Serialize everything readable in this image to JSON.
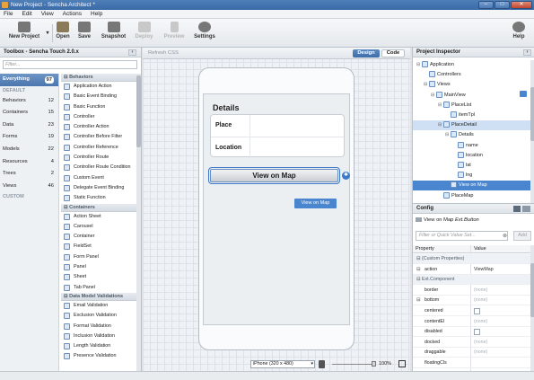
{
  "window": {
    "title": "New Project - Sencha Architect *",
    "minimize": "–",
    "maximize": "□",
    "close": "✕"
  },
  "menu": [
    "File",
    "Edit",
    "View",
    "Actions",
    "Help"
  ],
  "toolbar": {
    "new_project": "New Project",
    "open": "Open",
    "save": "Save",
    "snapshot": "Snapshot",
    "deploy": "Deploy",
    "preview": "Preview",
    "settings": "Settings",
    "help": "Help"
  },
  "toolbox": {
    "title": "Toolbox - Sencha Touch 2.0.x",
    "filter_placeholder": "Filter...",
    "categories": [
      {
        "label": "Everything",
        "count": "97"
      },
      {
        "label": "DEFAULT",
        "header": true
      },
      {
        "label": "Behaviors",
        "count": "12"
      },
      {
        "label": "Containers",
        "count": "15"
      },
      {
        "label": "Data",
        "count": "23"
      },
      {
        "label": "Forms",
        "count": "19"
      },
      {
        "label": "Models",
        "count": "22"
      },
      {
        "label": "Resources",
        "count": "4"
      },
      {
        "label": "Trees",
        "count": "2"
      },
      {
        "label": "Views",
        "count": "46"
      },
      {
        "label": "CUSTOM",
        "header": true
      }
    ],
    "groups": [
      {
        "name": "Behaviors",
        "items": [
          "Application Action",
          "Basic Event Binding",
          "Basic Function",
          "Controller",
          "Controller Action",
          "Controller Before Filter",
          "Controller Reference",
          "Controller Route",
          "Controller Route Condition",
          "Custom Event",
          "Delegate Event Binding",
          "Static Function"
        ]
      },
      {
        "name": "Containers",
        "items": [
          "Action Sheet",
          "Carousel",
          "Container",
          "FieldSet",
          "Form Panel",
          "Panel",
          "Sheet",
          "Tab Panel"
        ]
      },
      {
        "name": "Data Model Validations",
        "items": [
          "Email Validation",
          "Exclusion Validation",
          "Format Validation",
          "Inclusion Validation",
          "Length Validation",
          "Presence Validation"
        ]
      }
    ]
  },
  "canvas": {
    "refresh_css": "Refresh CSS",
    "design": "Design",
    "code": "Code",
    "form_title": "Details",
    "fields": [
      "Place",
      "Location"
    ],
    "button_label": "View on Map",
    "tooltip": "View on Map",
    "gear": "✱",
    "device": "iPhone (320 x 480)",
    "zoom": "100%"
  },
  "inspector": {
    "title": "Project Inspector",
    "nodes": [
      {
        "label": "Application",
        "level": 0,
        "toggle": "⊟"
      },
      {
        "label": "Controllers",
        "level": 1,
        "toggle": ""
      },
      {
        "label": "Views",
        "level": 1,
        "toggle": "⊟"
      },
      {
        "label": "MainView",
        "level": 2,
        "toggle": "⊟"
      },
      {
        "label": "PlaceList",
        "level": 3,
        "toggle": "⊟"
      },
      {
        "label": "itemTpl",
        "level": 4,
        "toggle": ""
      },
      {
        "label": "PlaceDetail",
        "level": 3,
        "toggle": "⊟",
        "highlight": "light"
      },
      {
        "label": "Details",
        "level": 4,
        "toggle": "⊟"
      },
      {
        "label": "name",
        "level": 5,
        "toggle": ""
      },
      {
        "label": "location",
        "level": 5,
        "toggle": ""
      },
      {
        "label": "lat",
        "level": 5,
        "toggle": ""
      },
      {
        "label": "lng",
        "level": 5,
        "toggle": ""
      },
      {
        "label": "View on Map",
        "level": 4,
        "toggle": "",
        "highlight": "selected"
      },
      {
        "label": "PlaceMap",
        "level": 3,
        "toggle": ""
      }
    ]
  },
  "config": {
    "title": "Config",
    "component": "View on Map",
    "component_type": "Ext.Button",
    "filter_placeholder": "Filter or Quick Value Set...",
    "add": "Add",
    "col_property": "Property",
    "col_value": "Value",
    "rows": [
      {
        "key": "Custom Properties",
        "section": true,
        "toggle": "⊟"
      },
      {
        "key": "action",
        "value": "ViewMap",
        "toggle": "⊟"
      },
      {
        "key": "Ext.Component",
        "section": true,
        "toggle": "⊟"
      },
      {
        "key": "border",
        "value": "(none)",
        "dim": true
      },
      {
        "key": "bottom",
        "value": "(none)",
        "dim": true,
        "toggle": "⊟"
      },
      {
        "key": "centered",
        "checkbox": true
      },
      {
        "key": "contentEl",
        "value": "(none)",
        "dim": true
      },
      {
        "key": "disabled",
        "checkbox": true
      },
      {
        "key": "docked",
        "value": "(none)",
        "dim": true
      },
      {
        "key": "draggable",
        "value": "(none)",
        "dim": true
      },
      {
        "key": "floatingCls",
        "value": "",
        "dim": true
      }
    ]
  },
  "colors": {
    "accent": "#3b79c6",
    "selection": "#4a85cf",
    "titlebar": "#3a6aa6"
  }
}
